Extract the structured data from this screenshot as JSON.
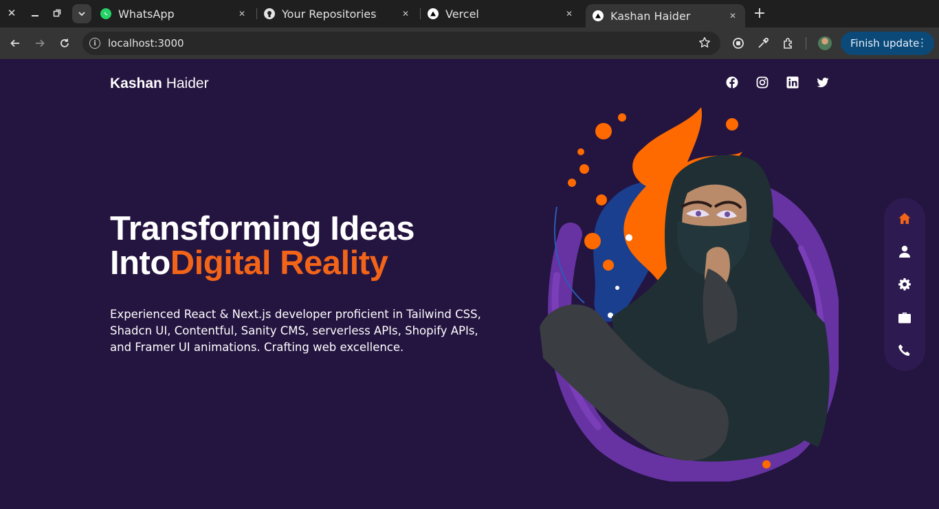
{
  "browser": {
    "tabs": [
      {
        "title": "WhatsApp",
        "icon": "whatsapp-icon"
      },
      {
        "title": "Your Repositories",
        "icon": "github-icon"
      },
      {
        "title": "Vercel",
        "icon": "vercel-icon"
      },
      {
        "title": "Kashan Haider",
        "icon": "vercel-icon",
        "active": true
      }
    ],
    "url": "localhost:3000",
    "update_button": "Finish update"
  },
  "site": {
    "logo_first": "Kashan",
    "logo_last": " Haider",
    "socials": [
      "facebook-icon",
      "instagram-icon",
      "linkedin-icon",
      "twitter-icon"
    ],
    "hero": {
      "line1": "Transforming Ideas",
      "line2_plain": "Into",
      "line2_accent": "Digital Reality",
      "description": "Experienced React & Next.js developer proficient in Tailwind CSS, Shadcn UI, Contentful, Sanity CMS, serverless APIs, Shopify APIs, and Framer UI animations. Crafting web excellence."
    },
    "sidenav": [
      "home-icon",
      "user-icon",
      "gear-icon",
      "briefcase-icon",
      "phone-icon"
    ]
  },
  "colors": {
    "background": "#241440",
    "accent": "#f26418",
    "sidenav_bg": "#2d1a50"
  }
}
